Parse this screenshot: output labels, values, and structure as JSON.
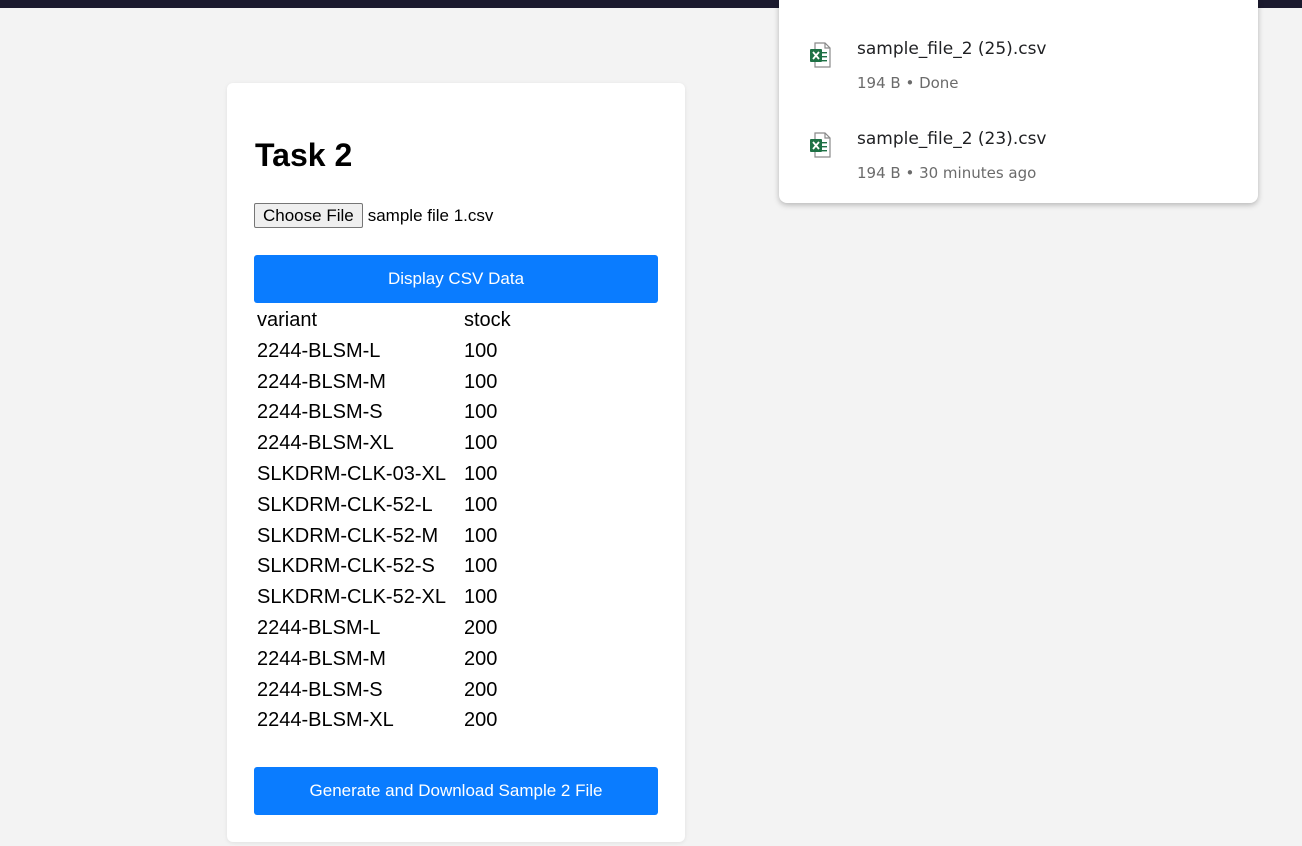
{
  "card": {
    "title": "Task 2",
    "choose_file_label": "Choose File",
    "file_name": "sample file 1.csv",
    "display_button": "Display CSV Data",
    "generate_button": "Generate and Download Sample 2 File"
  },
  "table": {
    "headers": [
      "variant",
      "stock"
    ],
    "rows": [
      [
        "2244-BLSM-L",
        "100"
      ],
      [
        "2244-BLSM-M",
        "100"
      ],
      [
        "2244-BLSM-S",
        "100"
      ],
      [
        "2244-BLSM-XL",
        "100"
      ],
      [
        "SLKDRM-CLK-03-XL",
        "100"
      ],
      [
        "SLKDRM-CLK-52-L",
        "100"
      ],
      [
        "SLKDRM-CLK-52-M",
        "100"
      ],
      [
        "SLKDRM-CLK-52-S",
        "100"
      ],
      [
        "SLKDRM-CLK-52-XL",
        "100"
      ],
      [
        "2244-BLSM-L",
        "200"
      ],
      [
        "2244-BLSM-M",
        "200"
      ],
      [
        "2244-BLSM-S",
        "200"
      ],
      [
        "2244-BLSM-XL",
        "200"
      ]
    ]
  },
  "downloads": {
    "items": [
      {
        "name": "sample_file_2 (25).csv",
        "meta": "194 B • Done",
        "icon": "excel-file-icon"
      },
      {
        "name": "sample_file_2 (23).csv",
        "meta": "194 B • 30 minutes ago",
        "icon": "excel-file-icon"
      }
    ]
  },
  "colors": {
    "accent": "#0a7cff",
    "excel_green": "#1e7145",
    "background": "#f3f3f3"
  }
}
